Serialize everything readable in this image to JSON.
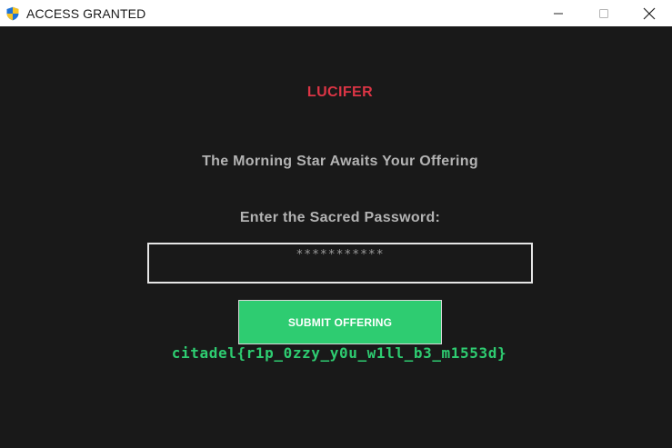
{
  "window": {
    "title": "ACCESS GRANTED",
    "icon": "uac-shield-icon",
    "controls": [
      "minimize-icon",
      "maximize-icon",
      "close-icon"
    ]
  },
  "main": {
    "heading": "LUCIFER",
    "subheading": "The Morning Star Awaits Your Offering",
    "prompt": "Enter the Sacred Password:",
    "password_value": "***********",
    "submit_label": "SUBMIT OFFERING",
    "flag": "citadel{r1p_0zzy_y0u_w1ll_b3_m1553d}"
  },
  "colors": {
    "background": "#191919",
    "heading": "#dc3545",
    "text": "#b3b3b3",
    "accent": "#2ecc71"
  }
}
